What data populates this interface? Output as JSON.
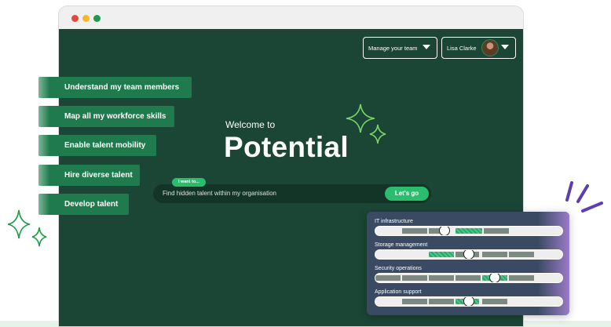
{
  "header": {
    "manage_label": "Manage your team",
    "user_name": "Lisa Clarke"
  },
  "hero": {
    "welcome": "Welcome to",
    "title": "Potential"
  },
  "search": {
    "badge": "I want to...",
    "text": "Find hidden talent within my organisation",
    "button": "Let's go"
  },
  "tabs": [
    {
      "label": "Understand my team members"
    },
    {
      "label": "Map all my workforce skills"
    },
    {
      "label": "Enable talent mobility"
    },
    {
      "label": "Hire diverse talent"
    },
    {
      "label": "Develop talent"
    }
  ],
  "skills": [
    {
      "name": "IT infrastructure",
      "level": 0.37
    },
    {
      "name": "Storage management",
      "level": 0.5
    },
    {
      "name": "Security operations",
      "level": 0.64
    },
    {
      "name": "Application support",
      "level": 0.5
    }
  ],
  "colors": {
    "background": "#1b4535",
    "accent": "#2bbd6e",
    "tab": "#1f7a4d"
  }
}
